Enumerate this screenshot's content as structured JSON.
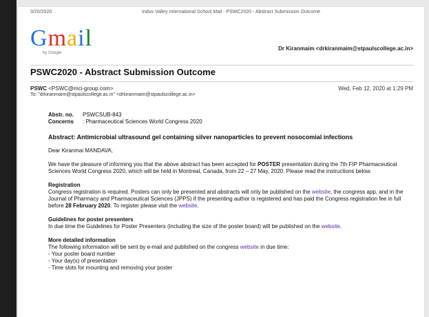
{
  "print_header": {
    "date": "3/20/2020",
    "title": "Indus Valley International School Mail - PSWC2020 - Abstract Submission Outcome"
  },
  "gmail": {
    "logo_text": [
      "G",
      "m",
      "a",
      "i",
      "l"
    ],
    "logo_sub": "by Google",
    "account": "Dr Kiranmaim <drkiranmaim@stpaulscollege.ac.in>"
  },
  "email": {
    "subject": "PSWC2020 - Abstract Submission Outcome",
    "from_name": "PSWC",
    "from_email": "<PSWC@mci-group.com>",
    "to": "To: \"drkiranmaim@stpaulscollege.ac.in\" <drkiranmaim@stpaulscollege.ac.in>",
    "timestamp": "Wed, Feb 12, 2020 at 1:29 PM"
  },
  "body": {
    "abstract_no_label": "Abstr. no.",
    "abstract_no_value": "PSWCSUB-843",
    "concerns_label": "Concerns",
    "concerns_value": ": Pharmaceutical Sciences World Congress 2020",
    "abstract_title": "Abstract: Antimicrobial ultrasound gel containing silver nanoparticles to prevent nosocomial infections",
    "greeting": "Dear Kiranmai MANDAVA,",
    "p1_before": "We have the pleasure of informing you that the above abstract has been accepted for ",
    "p1_bold": "POSTER",
    "p1_after": " presentation during the 7th FIP Pharmaceutical Sciences World Congress 2020, which will be held in Montreal, Canada, from 22 – 27 May, 2020. Please read the instructions below.",
    "registration_head": "Registration",
    "reg_text_1": "Congress registration is required. Posters can only be presented and abstracts will only be published on the ",
    "reg_link_1": "website",
    "reg_text_2": ", the congress app, and in the Journal of Pharmacy and Pharmaceutical Sciences (JPPS) if the presenting author is registered and has paid the Congress registration fee in full before ",
    "reg_bold_date": "28 February 2020",
    "reg_text_3": ". To register please visit the ",
    "reg_link_2": "website",
    "reg_text_4": ".",
    "guidelines_head": "Guidelines for poster presenters",
    "guidelines_text": "In due time the Guidelines for Poster Presenters (including the size of the poster board) will be published on the ",
    "guidelines_link": "website",
    "guidelines_end": ".",
    "more_head": "More detailed information",
    "more_text_1": "The following information will be sent by e-mail and published on the congress ",
    "more_link": "website",
    "more_text_2": " in due time:",
    "list": [
      "- Your poster board number",
      "- Your day(s) of presentation",
      "- Time slots for mounting and removing your poster"
    ]
  }
}
